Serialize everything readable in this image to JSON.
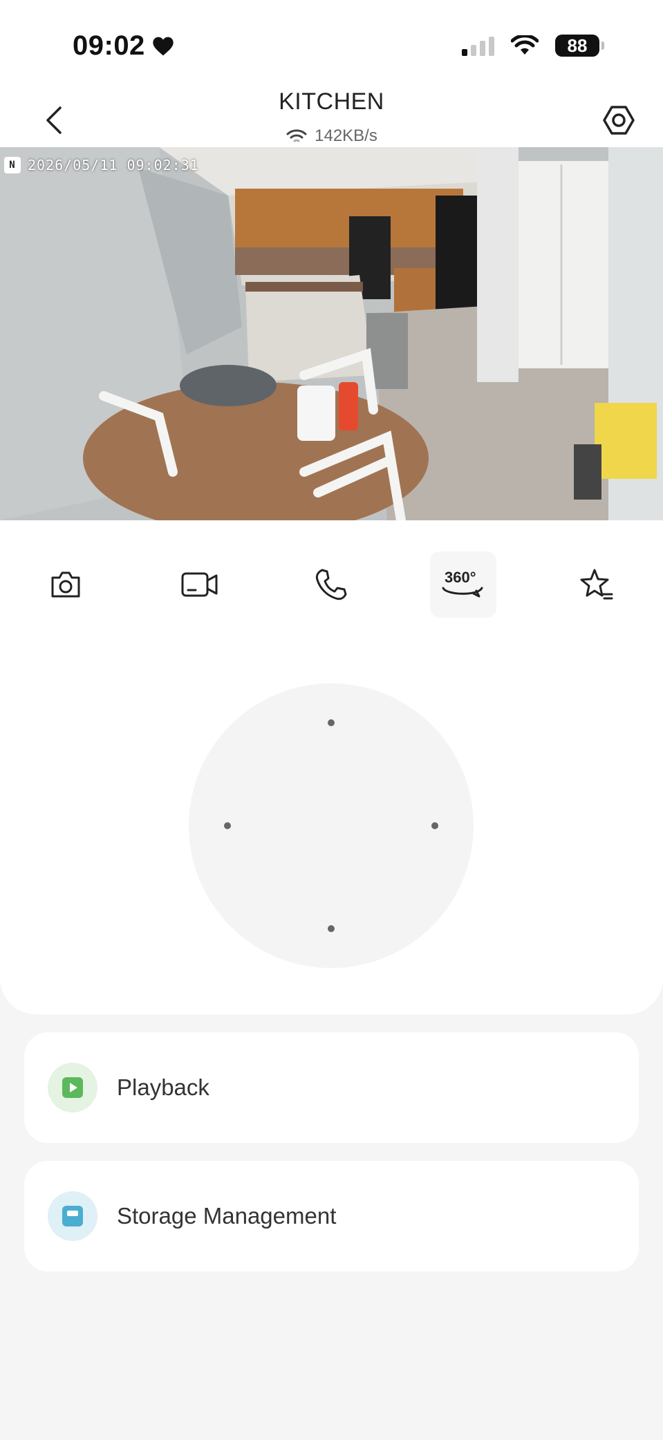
{
  "status_bar": {
    "time": "09:02",
    "battery": "88"
  },
  "header": {
    "title": "KITCHEN",
    "bitrate": "142KB/s"
  },
  "camera": {
    "timestamp": "2026/05/11 09:02:31",
    "badge": "N"
  },
  "toolbar": {
    "items": [
      {
        "icon": "camera-icon",
        "label": "Snapshot"
      },
      {
        "icon": "video-record-icon",
        "label": "Record"
      },
      {
        "icon": "phone-icon",
        "label": "Talk"
      },
      {
        "icon": "rotate-360-icon",
        "label": "360°",
        "active": true
      },
      {
        "icon": "star-list-icon",
        "label": "Favorites"
      }
    ],
    "rotate_text": "360°"
  },
  "menu": {
    "playback": {
      "label": "Playback",
      "icon": "play-icon",
      "color": "#5cb85c",
      "bg": "#e4f3e2"
    },
    "storage": {
      "label": "Storage Management",
      "icon": "storage-icon",
      "color": "#4aaed0",
      "bg": "#dff0f6"
    }
  }
}
